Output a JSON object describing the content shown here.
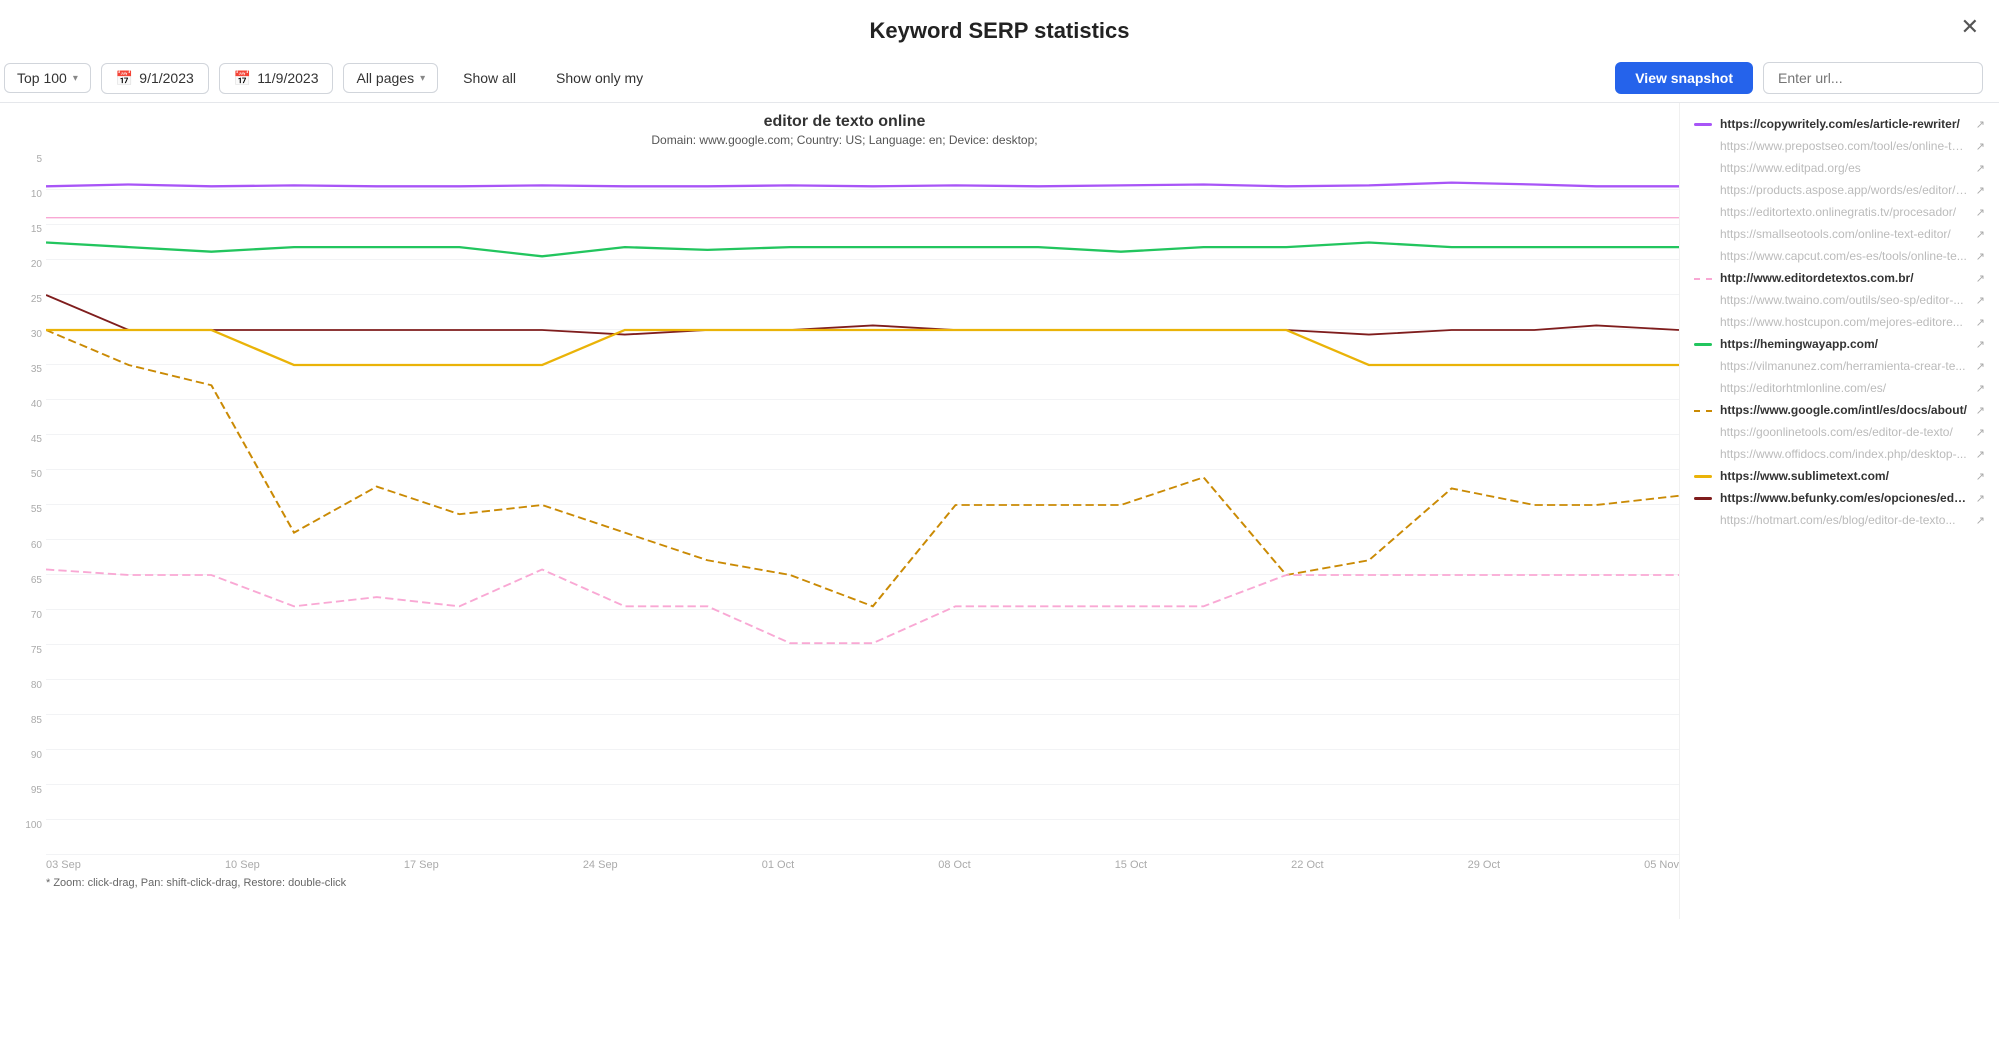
{
  "header": {
    "title": "Keyword SERP statistics",
    "close_label": "✕"
  },
  "toolbar": {
    "top100_label": "Top 100",
    "date_start": "9/1/2023",
    "date_end": "11/9/2023",
    "all_pages_label": "All pages",
    "show_all_label": "Show all",
    "show_only_label": "Show only my",
    "view_snapshot_label": "View snapshot",
    "url_placeholder": "Enter url..."
  },
  "chart": {
    "title": "editor de texto online",
    "subtitle_domain": "www.google.com",
    "subtitle_country": "US",
    "subtitle_language": "en",
    "subtitle_device": "desktop",
    "subtitle_full": "Domain: www.google.com; Country: US; Language: en; Device: desktop;",
    "zoom_hint": "* Zoom: click-drag, Pan: shift-click-drag, Restore: double-click",
    "y_labels": [
      "5",
      "10",
      "15",
      "20",
      "25",
      "30",
      "35",
      "40",
      "45",
      "50",
      "55",
      "60",
      "65",
      "70",
      "75",
      "80",
      "85",
      "90",
      "95",
      "100"
    ],
    "x_labels": [
      "03 Sep",
      "10 Sep",
      "17 Sep",
      "24 Sep",
      "01 Oct",
      "08 Oct",
      "15 Oct",
      "22 Oct",
      "29 Oct",
      "05 Nov"
    ]
  },
  "legend": {
    "items": [
      {
        "url": "https://copywritely.com/es/article-rewriter/",
        "color": "#a855f7",
        "type": "solid",
        "bold": true
      },
      {
        "url": "https://www.prepostseo.com/tool/es/online-te...",
        "color": "#f9a8d4",
        "type": "solid",
        "bold": false
      },
      {
        "url": "https://www.editpad.org/es",
        "color": "#f9a8d4",
        "type": "solid",
        "bold": false
      },
      {
        "url": "https://products.aspose.app/words/es/editor/txt",
        "color": "#f9a8d4",
        "type": "solid",
        "bold": false
      },
      {
        "url": "https://editortexto.onlinegratis.tv/procesador/",
        "color": "#f9a8d4",
        "type": "solid",
        "bold": false
      },
      {
        "url": "https://smallseotools.com/online-text-editor/",
        "color": "#f9a8d4",
        "type": "solid",
        "bold": false
      },
      {
        "url": "https://www.capcut.com/es-es/tools/online-te...",
        "color": "#f9a8d4",
        "type": "solid",
        "bold": false
      },
      {
        "url": "http://www.editordetextos.com.br/",
        "color": "#f9a8d4",
        "type": "dashed",
        "bold": true
      },
      {
        "url": "https://www.twaino.com/outils/seo-sp/editor-...",
        "color": "#f9a8d4",
        "type": "solid",
        "bold": false
      },
      {
        "url": "https://www.hostcupon.com/mejores-editore...",
        "color": "#f9a8d4",
        "type": "solid",
        "bold": false
      },
      {
        "url": "https://hemingwayapp.com/",
        "color": "#22c55e",
        "type": "solid",
        "bold": true
      },
      {
        "url": "https://vilmanunez.com/herramienta-crear-te...",
        "color": "#22c55e",
        "type": "solid",
        "bold": false
      },
      {
        "url": "https://editorhtmlonline.com/es/",
        "color": "#22c55e",
        "type": "solid",
        "bold": false
      },
      {
        "url": "https://www.google.com/intl/es/docs/about/",
        "color": "#eab308",
        "type": "dashed",
        "bold": true
      },
      {
        "url": "https://goonlinetools.com/es/editor-de-texto/",
        "color": "#eab308",
        "type": "solid",
        "bold": false
      },
      {
        "url": "https://www.offidocs.com/index.php/desktop-...",
        "color": "#eab308",
        "type": "solid",
        "bold": false
      },
      {
        "url": "https://www.sublimetext.com/",
        "color": "#eab308",
        "type": "solid",
        "bold": true
      },
      {
        "url": "https://www.befunky.com/es/opciones/editor-...",
        "color": "#7f1d1d",
        "type": "solid",
        "bold": true
      },
      {
        "url": "https://hotmart.com/es/blog/editor-de-texto...",
        "color": "#7f1d1d",
        "type": "solid",
        "bold": false
      }
    ]
  }
}
